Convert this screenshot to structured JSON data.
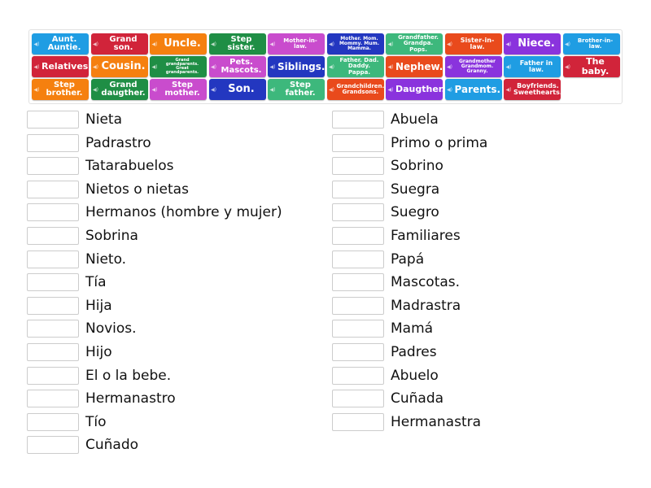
{
  "colors": {
    "lightblue": "#1f9de3",
    "red": "#d1243a",
    "orange": "#f5800f",
    "green": "#1f8e45",
    "magenta": "#c94ccd",
    "darkblue": "#2337c0",
    "teal": "#3db87c",
    "redorange": "#e94a1c",
    "purple": "#8a33dd"
  },
  "tiles": [
    [
      {
        "t": "Aunt. Auntie.",
        "c": "lightblue",
        "s": 10
      },
      {
        "t": "Grand son.",
        "c": "red",
        "s": 10
      },
      {
        "t": "Uncle.",
        "c": "orange",
        "s": 13
      },
      {
        "t": "Step sister.",
        "c": "green",
        "s": 10
      },
      {
        "t": "Mother-in-law.",
        "c": "magenta",
        "s": 7
      },
      {
        "t": "Mother. Mom. Mommy. Mum. Mamma.",
        "c": "darkblue",
        "s": 6
      },
      {
        "t": "Grandfather. Grandpa. Pops.",
        "c": "teal",
        "s": 7
      },
      {
        "t": "Sister-in-law.",
        "c": "redorange",
        "s": 8
      },
      {
        "t": "Niece.",
        "c": "purple",
        "s": 13
      },
      {
        "t": "Brother-in-law.",
        "c": "lightblue",
        "s": 7
      }
    ],
    [
      {
        "t": "Relatives.",
        "c": "red",
        "s": 11
      },
      {
        "t": "Cousin.",
        "c": "orange",
        "s": 13
      },
      {
        "t": "Grand grandparents. Great grandparents.",
        "c": "green",
        "s": 5
      },
      {
        "t": "Pets. Mascots.",
        "c": "magenta",
        "s": 10
      },
      {
        "t": "Siblings.",
        "c": "darkblue",
        "s": 12
      },
      {
        "t": "Father. Dad. Daddy. Pappa.",
        "c": "teal",
        "s": 7
      },
      {
        "t": "Nephew.",
        "c": "redorange",
        "s": 12
      },
      {
        "t": "Grandmother Grandmom. Granny.",
        "c": "purple",
        "s": 6
      },
      {
        "t": "Father in law.",
        "c": "lightblue",
        "s": 8
      },
      {
        "t": "The baby.",
        "c": "red",
        "s": 11
      }
    ],
    [
      {
        "t": "Step brother.",
        "c": "orange",
        "s": 10
      },
      {
        "t": "Grand daugther.",
        "c": "green",
        "s": 10
      },
      {
        "t": "Step mother.",
        "c": "magenta",
        "s": 10
      },
      {
        "t": "Son.",
        "c": "darkblue",
        "s": 13
      },
      {
        "t": "Step father.",
        "c": "teal",
        "s": 10
      },
      {
        "t": "Grandchildren. Grandsons.",
        "c": "redorange",
        "s": 7
      },
      {
        "t": "Daugther.",
        "c": "purple",
        "s": 11
      },
      {
        "t": "Parents.",
        "c": "lightblue",
        "s": 12
      },
      {
        "t": "Boyfriends. Sweethearts.",
        "c": "red",
        "s": 8
      }
    ]
  ],
  "left": [
    "Nieta",
    "Padrastro",
    "Tatarabuelos",
    "Nietos o nietas",
    "Hermanos (hombre y mujer)",
    "Sobrina",
    "Nieto.",
    "Tía",
    "Hija",
    "Novios.",
    "Hijo",
    "El o la bebe.",
    "Hermanastro",
    "Tío",
    "Cuñado"
  ],
  "right": [
    "Abuela",
    "Primo o prima",
    "Sobrino",
    "Suegra",
    "Suegro",
    "Familiares",
    "Papá",
    "Mascotas.",
    "Madrastra",
    "Mamá",
    "Padres",
    "Abuelo",
    "Cuñada",
    "Hermanastra"
  ]
}
